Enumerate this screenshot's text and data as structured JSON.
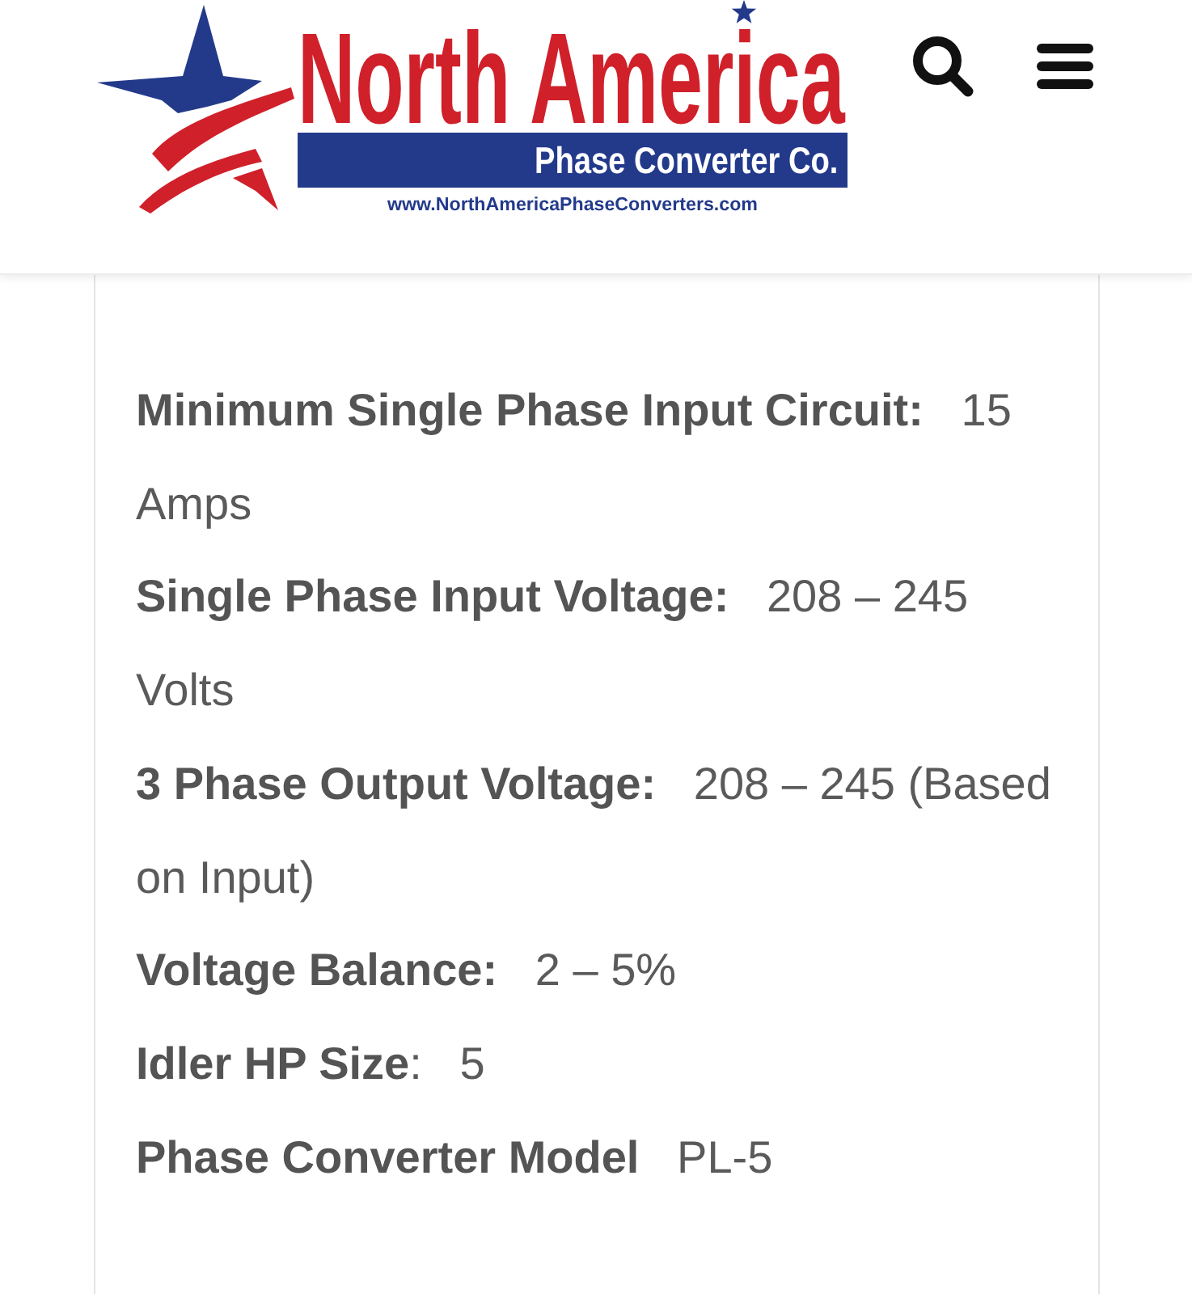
{
  "header": {
    "logo": {
      "title": "North America",
      "subtitle": "Phase Converter Co.",
      "url": "www.NorthAmericaPhaseConverters.com"
    },
    "actions": [
      {
        "kind": "search"
      },
      {
        "kind": "menu"
      }
    ]
  },
  "specs": [
    {
      "text": "**Minimum Single Phase Input Circuit:**   15 Amps"
    },
    {
      "text": "**Single Phase Input Voltage:**   208 – 245 Volts"
    },
    {
      "text": "**3 Phase Output Voltage:**   208 – 245 (Based on Input)"
    },
    {
      "text": "**Voltage Balance:**   2 – 5%"
    },
    {
      "text": "**Idler HP Size**:   5"
    },
    {
      "text": "**Phase Converter Model**   PL-5"
    }
  ]
}
